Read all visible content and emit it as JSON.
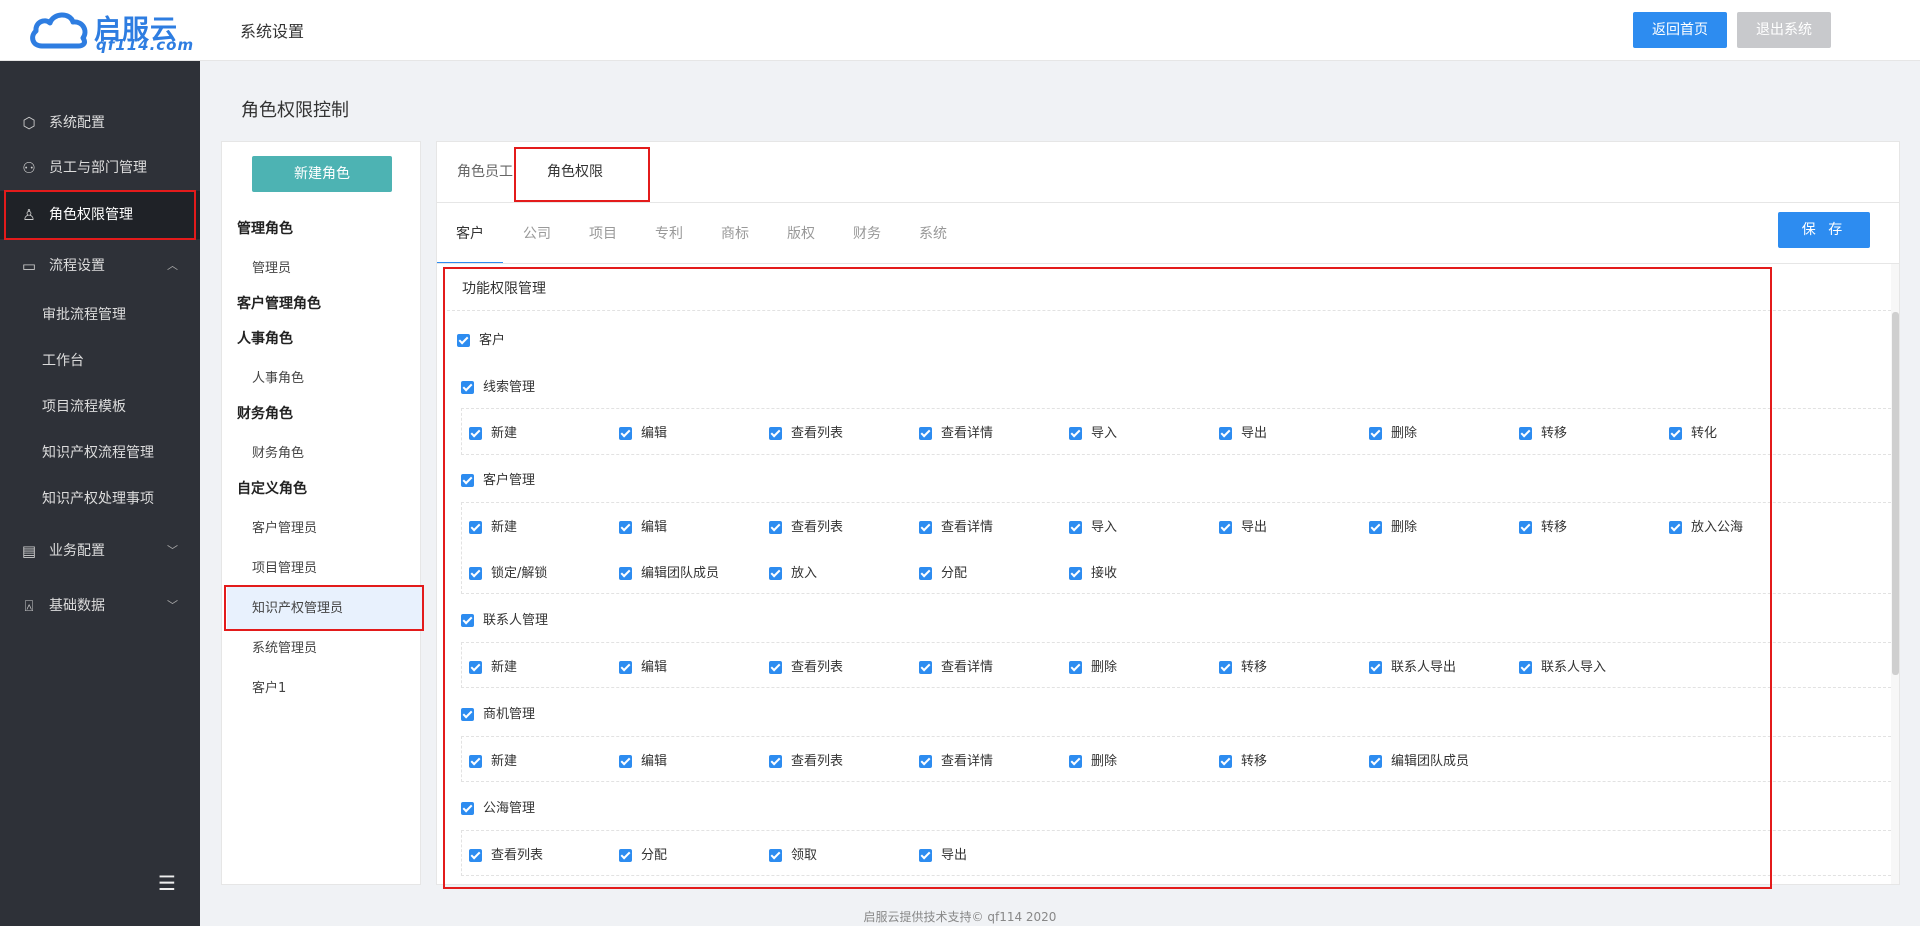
{
  "header": {
    "logo_text": "启服云",
    "logo_sub": "qf114.com",
    "title": "系统设置",
    "home_button": "返回首页",
    "logout_button": "退出系统"
  },
  "sidebar": {
    "items": [
      {
        "label": "系统配置",
        "icon": "gear-icon"
      },
      {
        "label": "员工与部门管理",
        "icon": "user-group-icon"
      },
      {
        "label": "角色权限管理",
        "icon": "user-icon"
      },
      {
        "label": "流程设置",
        "icon": "monitor-icon"
      },
      {
        "label": "业务配置",
        "icon": "document-icon"
      },
      {
        "label": "基础数据",
        "icon": "stamp-icon"
      }
    ],
    "flow_children": [
      "审批流程管理",
      "工作台",
      "项目流程模板",
      "知识产权流程管理",
      "知识产权处理事项"
    ]
  },
  "page_title": "角色权限控制",
  "roles": {
    "new_button": "新建角色",
    "groups": {
      "g1": "管理角色",
      "g1_items": [
        "管理员"
      ],
      "g2": "客户管理角色",
      "g3": "人事角色",
      "g3_items": [
        "人事角色"
      ],
      "g4": "财务角色",
      "g4_items": [
        "财务角色"
      ],
      "g5": "自定义角色",
      "g5_items": [
        "客户管理员",
        "项目管理员",
        "知识产权管理员",
        "系统管理员",
        "客户1"
      ]
    },
    "selected": "知识产权管理员"
  },
  "tabs": {
    "primary": [
      "角色员工",
      "角色权限"
    ],
    "primary_active": "角色权限",
    "secondary": [
      "客户",
      "公司",
      "项目",
      "专利",
      "商标",
      "版权",
      "财务",
      "系统"
    ],
    "secondary_active": "客户"
  },
  "save_button": "保 存",
  "permissions": {
    "header": "功能权限管理",
    "top": "客户",
    "sections": [
      {
        "name": "线索管理",
        "items": [
          "新建",
          "编辑",
          "查看列表",
          "查看详情",
          "导入",
          "导出",
          "删除",
          "转移",
          "转化"
        ]
      },
      {
        "name": "客户管理",
        "items": [
          "新建",
          "编辑",
          "查看列表",
          "查看详情",
          "导入",
          "导出",
          "删除",
          "转移",
          "放入公海",
          "锁定/解锁",
          "编辑团队成员",
          "放入",
          "分配",
          "接收"
        ]
      },
      {
        "name": "联系人管理",
        "items": [
          "新建",
          "编辑",
          "查看列表",
          "查看详情",
          "删除",
          "转移",
          "联系人导出",
          "联系人导入"
        ]
      },
      {
        "name": "商机管理",
        "items": [
          "新建",
          "编辑",
          "查看列表",
          "查看详情",
          "删除",
          "转移",
          "编辑团队成员"
        ]
      },
      {
        "name": "公海管理",
        "items": [
          "查看列表",
          "分配",
          "领取",
          "导出"
        ]
      }
    ]
  },
  "footer": "启服云提供技术支持© qf114 2020",
  "colors": {
    "primary": "#2d8cf0",
    "teal": "#4db3b3",
    "sidebar_bg": "#2e3138",
    "highlight_border": "#e31b1b"
  }
}
